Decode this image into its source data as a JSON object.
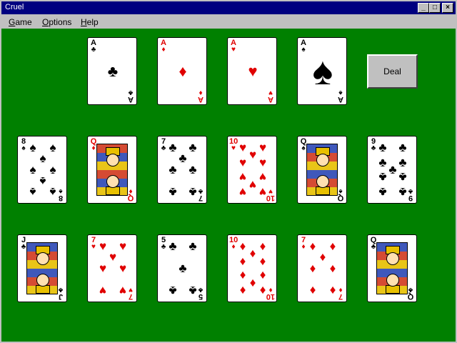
{
  "window": {
    "title": "Cruel",
    "minimize_glyph": "_",
    "maximize_glyph": "□",
    "close_glyph": "×"
  },
  "menu": [
    {
      "label": "Game",
      "accel": "G",
      "rest": "ame"
    },
    {
      "label": "Options",
      "accel": "O",
      "rest": "ptions"
    },
    {
      "label": "Help",
      "accel": "H",
      "rest": "elp"
    }
  ],
  "deal_button": "Deal",
  "colors": {
    "felt": "#008000",
    "red_suit": "#e00000",
    "title_bar": "#000080"
  },
  "foundations": [
    {
      "rank": "A",
      "suit": "♣",
      "color": "black"
    },
    {
      "rank": "A",
      "suit": "♦",
      "color": "red"
    },
    {
      "rank": "A",
      "suit": "♥",
      "color": "red"
    },
    {
      "rank": "A",
      "suit": "♠",
      "color": "black"
    }
  ],
  "tableau_row1": [
    {
      "rank": "8",
      "suit": "♠",
      "color": "black"
    },
    {
      "rank": "Q",
      "suit": "♦",
      "color": "red"
    },
    {
      "rank": "7",
      "suit": "♣",
      "color": "black"
    },
    {
      "rank": "10",
      "suit": "♥",
      "color": "red"
    },
    {
      "rank": "Q",
      "suit": "♠",
      "color": "black"
    },
    {
      "rank": "9",
      "suit": "♣",
      "color": "black"
    }
  ],
  "tableau_row2": [
    {
      "rank": "J",
      "suit": "♣",
      "color": "black"
    },
    {
      "rank": "7",
      "suit": "♥",
      "color": "red"
    },
    {
      "rank": "5",
      "suit": "♣",
      "color": "black"
    },
    {
      "rank": "10",
      "suit": "♦",
      "color": "red"
    },
    {
      "rank": "7",
      "suit": "♦",
      "color": "red"
    },
    {
      "rank": "Q",
      "suit": "♣",
      "color": "black"
    }
  ]
}
